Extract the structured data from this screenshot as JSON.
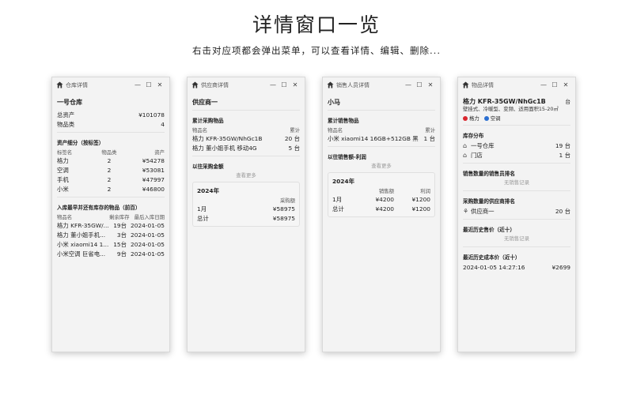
{
  "page": {
    "title": "详情窗口一览",
    "subtitle": "右击对应项都会弹出菜单，可以查看详情、编辑、删除..."
  },
  "controls": {
    "minimize": "—",
    "maximize": "☐",
    "close": "✕"
  },
  "warehouse": {
    "window_title": "仓库详情",
    "name": "一号仓库",
    "total_assets_label": "总资产",
    "total_assets": "¥101078",
    "category_count_label": "物品类",
    "category_count": "4",
    "breakdown_title": "资产细分（按标签）",
    "breakdown_headers": [
      "标签名",
      "物品类",
      "资产"
    ],
    "breakdown_rows": [
      {
        "tag": "格力",
        "count": "2",
        "value": "¥54278"
      },
      {
        "tag": "空调",
        "count": "2",
        "value": "¥53081"
      },
      {
        "tag": "手机",
        "count": "2",
        "value": "¥47997"
      },
      {
        "tag": "小米",
        "count": "2",
        "value": "¥46800"
      }
    ],
    "stock_title": "入库最早并还有库存的物品（前百）",
    "stock_headers": [
      "物品名",
      "剩余库存",
      "最后入库日期"
    ],
    "stock_rows": [
      {
        "name": "格力 KFR-35GW/...",
        "left": "19台",
        "date": "2024-01-05"
      },
      {
        "name": "格力 董小姐手机...",
        "left": "3台",
        "date": "2024-01-05"
      },
      {
        "name": "小米 xiaomi14 1...",
        "left": "15台",
        "date": "2024-01-05"
      },
      {
        "name": "小米空调 巨省电...",
        "left": "9台",
        "date": "2024-01-05"
      }
    ]
  },
  "supplier": {
    "window_title": "供应商详情",
    "name": "供应商一",
    "purchase_title": "累计采购物品",
    "purchase_headers": [
      "物品名",
      "累计"
    ],
    "purchase_rows": [
      {
        "name": "格力 KFR-35GW/NhGc1B",
        "qty": "20 台"
      },
      {
        "name": "格力 董小姐手机 移动4G",
        "qty": "5 台"
      }
    ],
    "amount_title": "以往采购金额",
    "view_more": "查看更多",
    "year": "2024年",
    "amount_header": "采购额",
    "amount_rows": [
      {
        "label": "1月",
        "value": "¥58975"
      },
      {
        "label": "总计",
        "value": "¥58975"
      }
    ]
  },
  "salesperson": {
    "window_title": "销售人员详情",
    "name": "小马",
    "sales_title": "累计销售物品",
    "sales_headers": [
      "物品名",
      "累计"
    ],
    "sales_rows": [
      {
        "name": "小米 xiaomi14 16GB+512GB 黑",
        "qty": "1 台"
      }
    ],
    "profit_title": "以往销售额-利润",
    "view_more": "查看更多",
    "year": "2024年",
    "profit_headers": [
      "销售额",
      "利润"
    ],
    "profit_rows": [
      {
        "label": "1月",
        "sales": "¥4200",
        "profit": "¥1200"
      },
      {
        "label": "总计",
        "sales": "¥4200",
        "profit": "¥1200"
      }
    ]
  },
  "item": {
    "window_title": "物品详情",
    "name": "格力 KFR-35GW/NhGc1B",
    "unit": "台",
    "description": "壁挂式、冷暖型、变频、适用面积15-20㎡",
    "tags": [
      {
        "label": "格力",
        "color": "#d9262e"
      },
      {
        "label": "空调",
        "color": "#2b6fd1"
      }
    ],
    "inventory_title": "库存分布",
    "inventory_rows": [
      {
        "name": "一号仓库",
        "qty": "19 台"
      },
      {
        "name": "门店",
        "qty": "1 台"
      }
    ],
    "sales_rank_title": "销售数量的销售员排名",
    "sales_rank_empty": "无销售记录",
    "supplier_rank_title": "采购数量的供应商排名",
    "supplier_rank_rows": [
      {
        "name": "供应商一",
        "qty": "20 台"
      }
    ],
    "recent_price_title": "最近历史售价（近十）",
    "recent_price_empty": "无销售记录",
    "recent_cost_title": "最近历史成本价（近十）",
    "recent_cost_rows": [
      {
        "date": "2024-01-05 14:27:16",
        "price": "¥2699"
      }
    ]
  }
}
